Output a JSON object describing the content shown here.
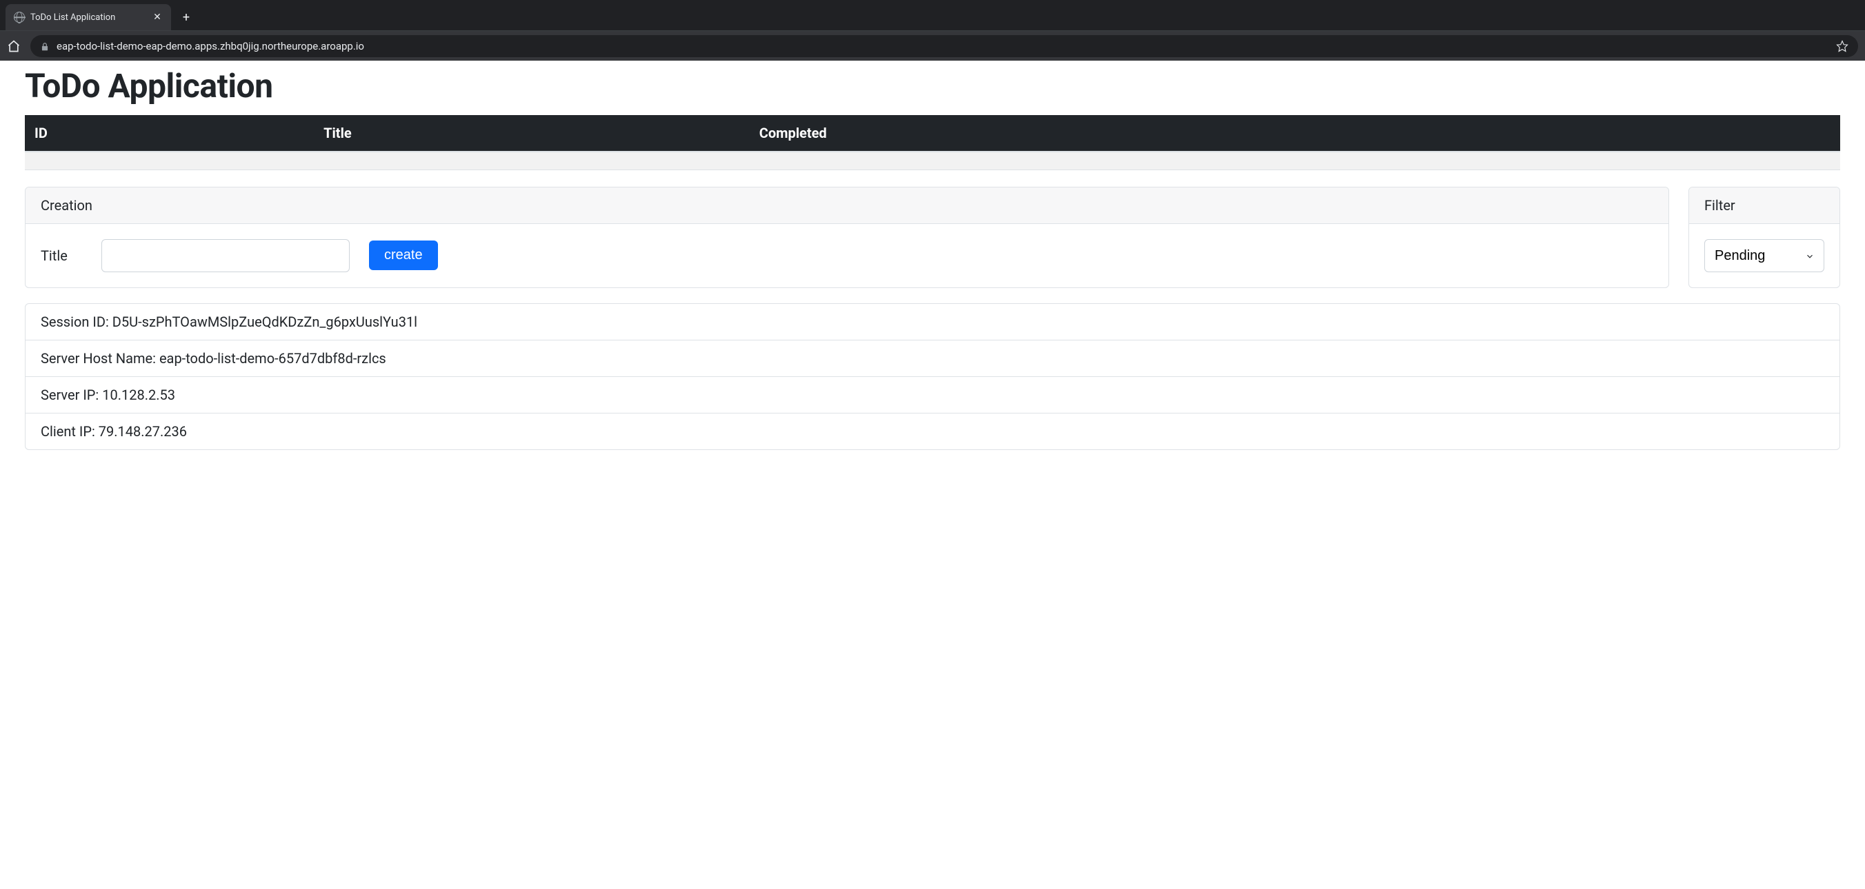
{
  "browser": {
    "tab_title": "ToDo List Application",
    "url": "eap-todo-list-demo-eap-demo.apps.zhbq0jig.northeurope.aroapp.io"
  },
  "page": {
    "title": "ToDo Application"
  },
  "table": {
    "columns": [
      "ID",
      "Title",
      "Completed"
    ]
  },
  "creation": {
    "header": "Creation",
    "title_label": "Title",
    "title_value": "",
    "create_button": "create"
  },
  "filter": {
    "header": "Filter",
    "selected": "Pending"
  },
  "info": {
    "session_label": "Session ID:",
    "session_value": "D5U-szPhTOawMSlpZueQdKDzZn_g6pxUuslYu31l",
    "server_host_label": "Server Host Name:",
    "server_host_value": "eap-todo-list-demo-657d7dbf8d-rzlcs",
    "server_ip_label": "Server IP:",
    "server_ip_value": "10.128.2.53",
    "client_ip_label": "Client IP:",
    "client_ip_value": "79.148.27.236"
  }
}
